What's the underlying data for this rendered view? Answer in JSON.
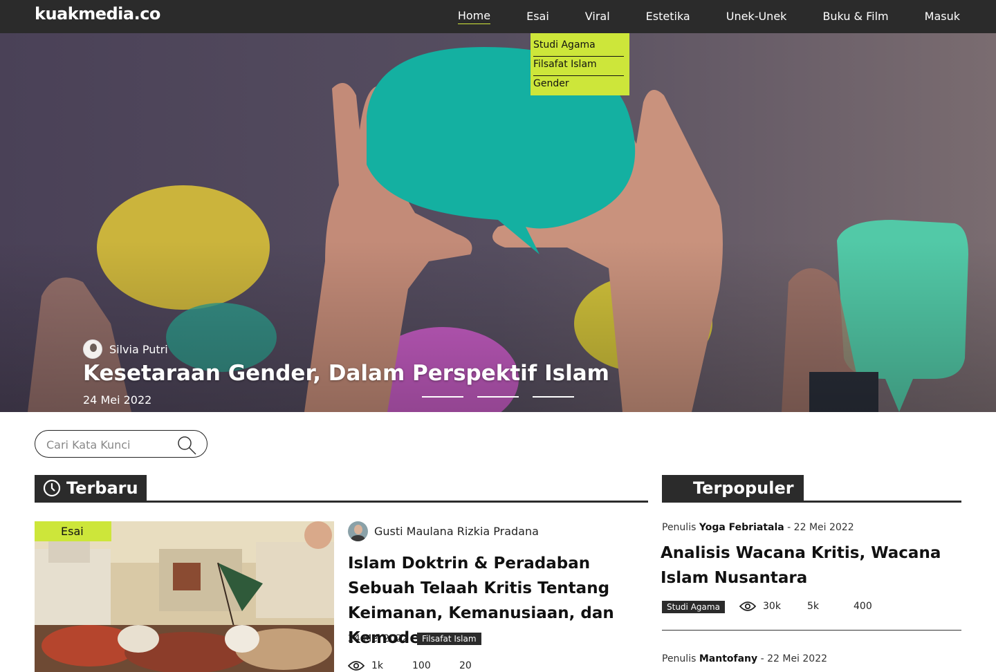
{
  "brand": "kuakmedia.co",
  "nav": {
    "items": [
      "Home",
      "Esai",
      "Viral",
      "Estetika",
      "Unek-Unek",
      "Buku & Film",
      "Masuk"
    ],
    "active": "Home"
  },
  "dropdown": {
    "items": [
      "Studi Agama",
      "Filsafat Islam",
      "Gender"
    ]
  },
  "hero": {
    "author": "Silvia Putri",
    "title": "Kesetaraan Gender, Dalam Perspektif Islam",
    "date": "24 Mei 2022",
    "slide_count": 3
  },
  "search": {
    "placeholder": "Cari Kata Kunci"
  },
  "latest": {
    "heading": "Terbaru",
    "article": {
      "category": "Esai",
      "author": "Gusti Maulana Rizkia Pradana",
      "title": "Islam Doktrin & Peradaban  Sebuah Telaah Kritis Tentang Keimanan, Kemanusiaan, dan Kemodernan",
      "date": "24 Mei 2022",
      "tag": "Filsafat Islam",
      "views": "1k",
      "stat2": "100",
      "stat3": "20"
    }
  },
  "popular": {
    "heading": "Terpopuler",
    "items": [
      {
        "author_prefix": "Penulis",
        "author": "Yoga Febriatala",
        "date": "- 22 Mei 2022",
        "title": "Analisis Wacana Kritis, Wacana Islam Nusantara",
        "tag": "Studi Agama",
        "views": "30k",
        "stat2": "5k",
        "stat3": "400"
      },
      {
        "author_prefix": "Penulis",
        "author": "Mantofany",
        "date": "- 22 Mei 2022"
      }
    ]
  },
  "colors": {
    "accent": "#cde63a",
    "dark": "#2b2b2b"
  }
}
